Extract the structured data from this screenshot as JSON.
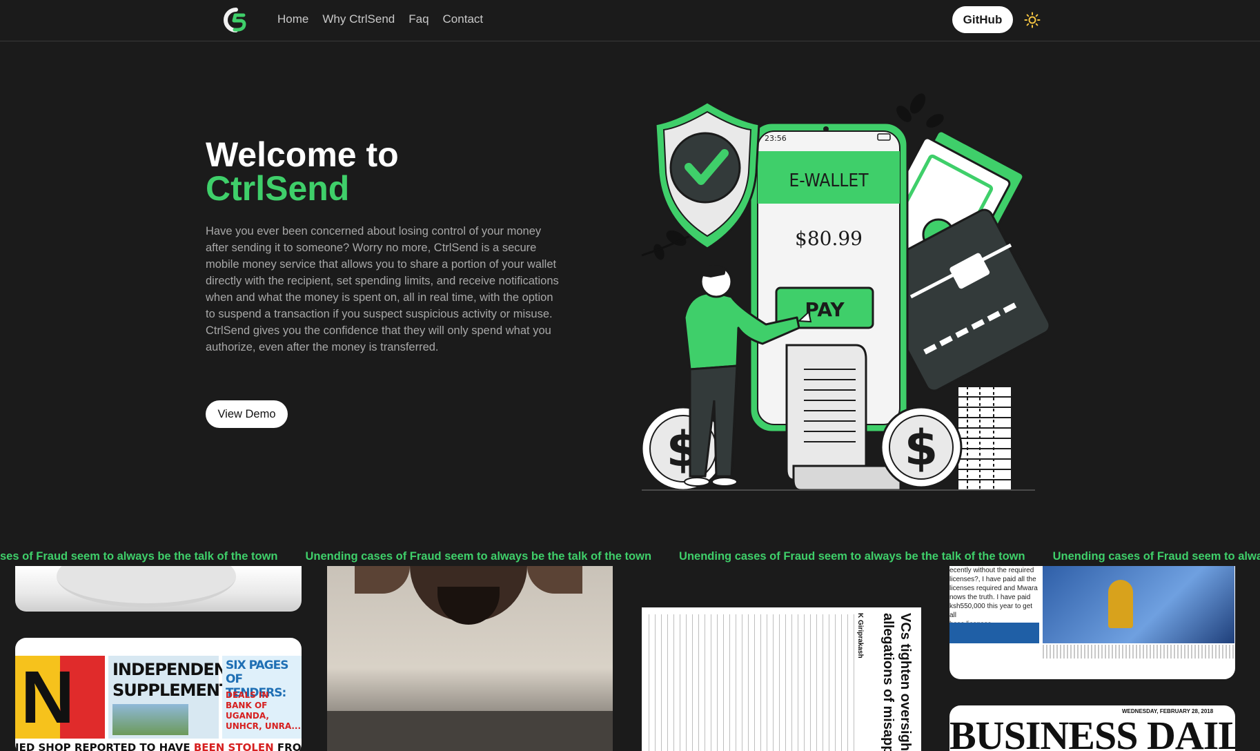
{
  "nav": {
    "logo_alt": "CtrlSend logo",
    "links": [
      "Home",
      "Why CtrlSend",
      "Faq",
      "Contact"
    ],
    "github_label": "GitHub",
    "theme_icon": "sun-icon"
  },
  "hero": {
    "title_line1": "Welcome to",
    "title_line2": "CtrlSend",
    "description": "Have you ever been concerned about losing control of your money after sending it to someone? Worry no more, CtrlSend is a secure mobile money service that allows you to share a portion of your wallet directly with the recipient, set spending limits, and receive notifications when and what the money is spent on, all in real time, with the option to suspend a transaction if you suspect suspicious activity or misuse. CtrlSend gives you the confidence that they will only spend what you authorize, even after the money is transferred.",
    "demo_label": "View Demo",
    "illustration": {
      "phone_time": "23:56",
      "wallet_label": "E-WALLET",
      "balance": "$80.99",
      "pay_label": "PAY",
      "coin_symbol": "$"
    }
  },
  "marquee": {
    "text": "Unending cases of Fraud seem to always be the talk of the town",
    "partial_text": "ses of Fraud seem to always be the talk of the town"
  },
  "gallery": {
    "newspaper1": {
      "headline1": "INDEPENDENCE",
      "headline2": "SUPPLEMENT",
      "tenders1": "SIX PAGES",
      "tenders2": "OF TENDERS:",
      "tenders3": "DEALS IN",
      "tenders4": "BANK OF",
      "tenders5": "UGANDA,",
      "tenders6": "UNHCR, UNRA...",
      "bottom_a": "IED SHOP REPORTED TO HAVE ",
      "bottom_b": "BEEN STOLEN",
      "bottom_c": " FROM TELECOMS"
    },
    "article": {
      "headline": "VCs tighten oversight as",
      "subheadline": "allegations of misappropr",
      "byline": "K Giriprakash"
    },
    "newspaper2": {
      "quote1": "ecently without the required",
      "quote2": "licenses?, I have paid all the",
      "quote3": "licenses required and Mwara",
      "quote4": "nows the truth. I have paid",
      "quote5": "ksh550,000 this year to get all",
      "quote6": "hese licenses."
    },
    "masthead": "BUSINESS DAILY",
    "masthead_date": "WEDNESDAY, FEBRUARY 28, 2018"
  },
  "colors": {
    "background": "#1b1b1b",
    "accent": "#3fcf6a",
    "text_muted": "#a8a8a8"
  }
}
